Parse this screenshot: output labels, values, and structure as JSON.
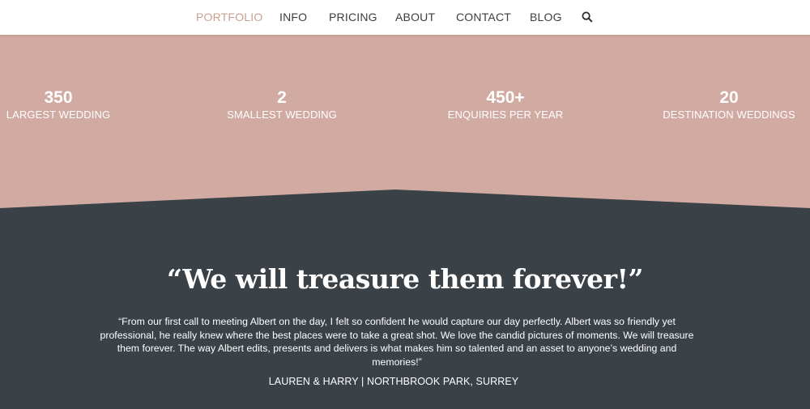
{
  "nav": {
    "items": [
      {
        "label": "PORTFOLIO",
        "active": true
      },
      {
        "label": "INFO"
      },
      {
        "label": "PRICING"
      },
      {
        "label": "ABOUT"
      },
      {
        "label": "CONTACT"
      },
      {
        "label": "BLOG"
      }
    ],
    "search_icon": "search-icon"
  },
  "stats": [
    {
      "value": "350",
      "label": "LARGEST WEDDING"
    },
    {
      "value": "2",
      "label": "SMALLEST WEDDING"
    },
    {
      "value": "450+",
      "label": "ENQUIRIES PER YEAR"
    },
    {
      "value": "20",
      "label": "DESTINATION WEDDINGS"
    }
  ],
  "testimonial": {
    "title": "“We will treasure them forever!”",
    "body": "“From our first call to meeting Albert on the day, I felt so confident he would capture our day perfectly. Albert was so friendly yet professional, he really knew where the best places were to take a great shot. We love the candid pictures of moments. We will treasure them forever. The way Albert edits, presents and delivers is what makes him so talented and an asset to anyone’s wedding and memories!”",
    "author": "LAUREN & HARRY | NORTHBROOK PARK, SURREY"
  },
  "colors": {
    "accent": "#c9a090",
    "band": "#d1aaa1",
    "dark": "#3a4147"
  }
}
